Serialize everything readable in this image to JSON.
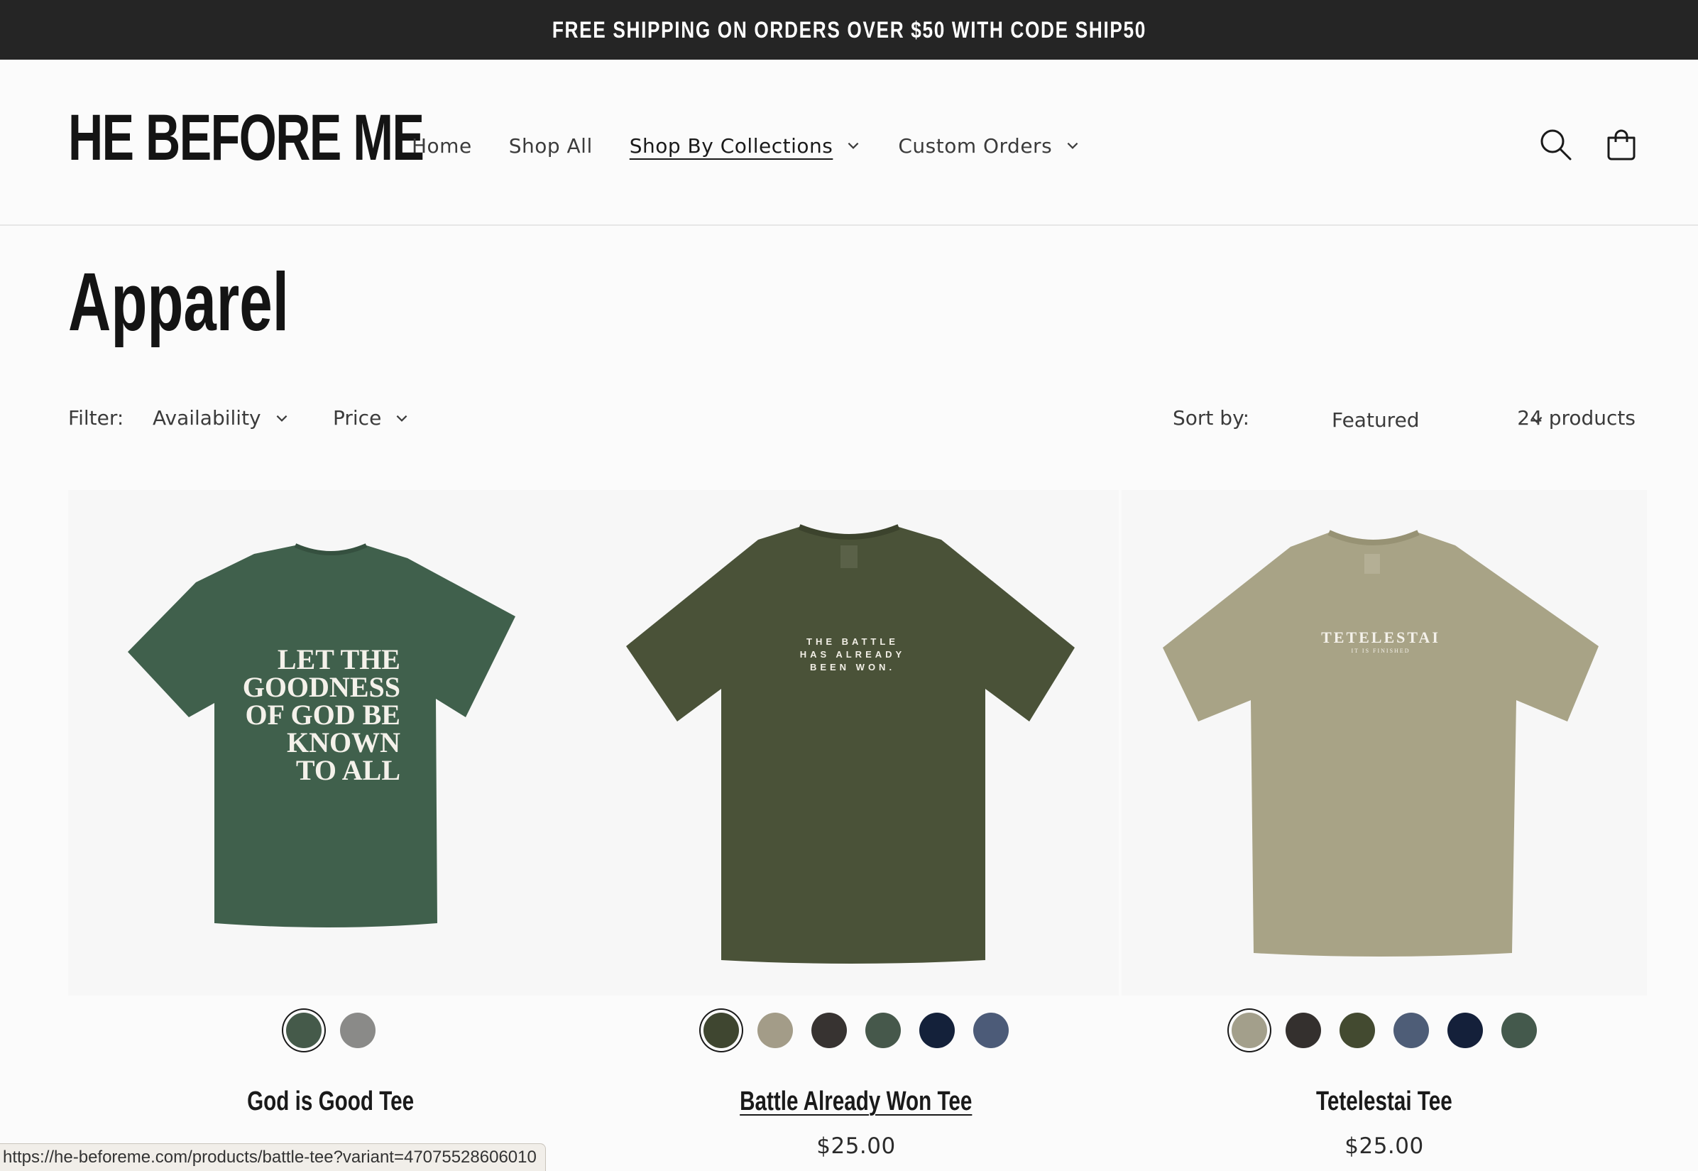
{
  "announcement": {
    "text": "FREE SHIPPING ON ORDERS OVER $50 WITH CODE SHIP50"
  },
  "header": {
    "logo": "HE BEFORE ME",
    "nav": [
      {
        "label": "Home",
        "has_dropdown": false,
        "active": false
      },
      {
        "label": "Shop All",
        "has_dropdown": false,
        "active": false
      },
      {
        "label": "Shop By Collections",
        "has_dropdown": true,
        "active": true
      },
      {
        "label": "Custom Orders",
        "has_dropdown": true,
        "active": false
      }
    ],
    "icons": [
      "search-icon",
      "cart-icon"
    ]
  },
  "page": {
    "title": "Apparel"
  },
  "filters": {
    "label": "Filter:",
    "availability": "Availability",
    "price": "Price",
    "sort_label": "Sort by:",
    "sort_value": "Featured",
    "count": "24 products"
  },
  "products": [
    {
      "title": "God is Good Tee",
      "price": "",
      "shirt_color": "#40604c",
      "print_text": [
        "LET THE",
        "GOODNESS",
        "OF GOD BE",
        "KNOWN",
        "TO ALL"
      ],
      "swatches": [
        "#455a4a",
        "#8a8a88"
      ],
      "selected_swatch": 0
    },
    {
      "title": "Battle Already Won Tee",
      "price": "$25.00",
      "shirt_color": "#4a5238",
      "print_text": [
        "THE BATTLE",
        "HAS ALREADY",
        "BEEN WON."
      ],
      "swatches": [
        "#3f4630",
        "#a39c88",
        "#373331",
        "#46584b",
        "#14213a",
        "#4c5b78"
      ],
      "selected_swatch": 0
    },
    {
      "title": "Tetelestai Tee",
      "price": "$25.00",
      "shirt_color": "#a8a386",
      "print_text": [
        "TETELESTAI",
        "IT IS FINISHED"
      ],
      "swatches": [
        "#a39f8b",
        "#34302e",
        "#434a30",
        "#4e5d77",
        "#14203a",
        "#44594c"
      ],
      "selected_swatch": 0
    }
  ],
  "status_bar": {
    "url": "https://he-beforeme.com/products/battle-tee?variant=47075528606010"
  }
}
